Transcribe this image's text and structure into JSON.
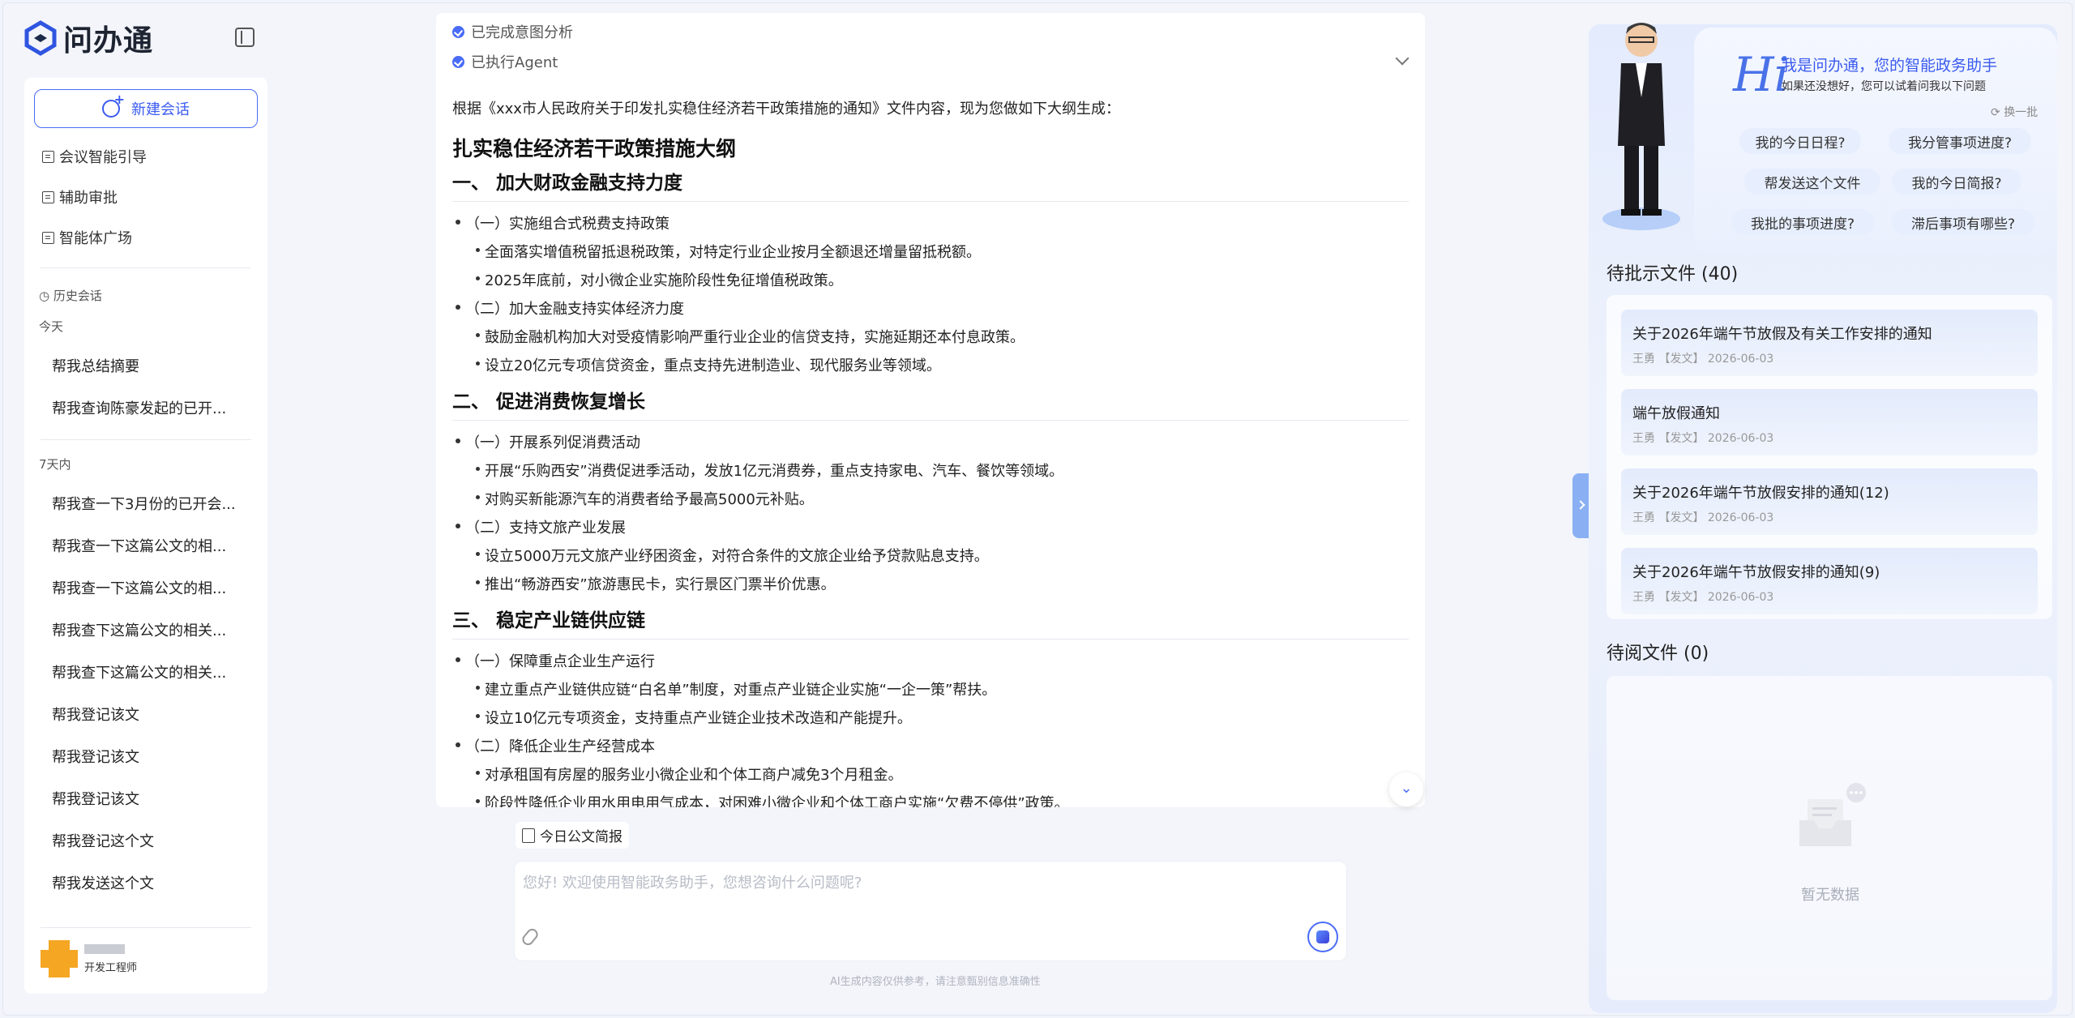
{
  "app": {
    "logo_text": "问办通"
  },
  "sidebar": {
    "new_chat_label": "新建会话",
    "nav": [
      "会议智能引导",
      "辅助审批",
      "智能体广场"
    ],
    "history_label": "历史会话",
    "groups": [
      {
        "label": "今天",
        "items": [
          "帮我总结摘要",
          "帮我查询陈豪发起的已开..."
        ]
      },
      {
        "label": "7天内",
        "items": [
          "帮我查一下3月份的已开会...",
          "帮我查一下这篇公文的相...",
          "帮我查一下这篇公文的相...",
          "帮我查下这篇公文的相关...",
          "帮我查下这篇公文的相关...",
          "帮我登记该文",
          "帮我登记该文",
          "帮我登记该文",
          "帮我登记这个文",
          "帮我发送这个文"
        ]
      }
    ],
    "user": {
      "role": "开发工程师"
    }
  },
  "chat": {
    "steps": [
      "已完成意图分析",
      "已执行Agent"
    ],
    "intro": "根据《xxx市人民政府关于印发扎实稳住经济若干政策措施的通知》文件内容，现为您做如下大纲生成：",
    "doc_title": "扎实稳住经济若干政策措施大纲",
    "sections": [
      {
        "title": "一、 加大财政金融支持力度",
        "items": [
          {
            "label": "（一）实施组合式税费支持政策",
            "subs": [
              "全面落实增值税留抵退税政策，对特定行业企业按月全额退还增量留抵税额。",
              "2025年底前，对小微企业实施阶段性免征增值税政策。"
            ]
          },
          {
            "label": "（二）加大金融支持实体经济力度",
            "subs": [
              "鼓励金融机构加大对受疫情影响严重行业企业的信贷支持，实施延期还本付息政策。",
              "设立20亿元专项信贷资金，重点支持先进制造业、现代服务业等领域。"
            ]
          }
        ]
      },
      {
        "title": "二、 促进消费恢复增长",
        "items": [
          {
            "label": "（一）开展系列促消费活动",
            "subs": [
              "开展“乐购西安”消费促进季活动，发放1亿元消费券，重点支持家电、汽车、餐饮等领域。",
              "对购买新能源汽车的消费者给予最高5000元补贴。"
            ]
          },
          {
            "label": "（二）支持文旅产业发展",
            "subs": [
              "设立5000万元文旅产业纾困资金，对符合条件的文旅企业给予贷款贴息支持。",
              "推出“畅游西安”旅游惠民卡，实行景区门票半价优惠。"
            ]
          }
        ]
      },
      {
        "title": "三、 稳定产业链供应链",
        "items": [
          {
            "label": "（一）保障重点企业生产运行",
            "subs": [
              "建立重点产业链供应链“白名单”制度，对重点产业链企业实施“一企一策”帮扶。",
              "设立10亿元专项资金，支持重点产业链企业技术改造和产能提升。"
            ]
          },
          {
            "label": "（二）降低企业生产经营成本",
            "subs": [
              "对承租国有房屋的服务业小微企业和个体工商户减免3个月租金。",
              "阶段性降低企业用水用电用气成本，对困难小微企业和个体工商户实施“欠费不停供”政策。"
            ]
          }
        ]
      }
    ],
    "brief_chip": "今日公文简报",
    "input_placeholder": "您好! 欢迎使用智能政务助手，您想咨询什么问题呢?",
    "disclaimer": "AI生成内容仅供参考，请注意甄别信息准确性"
  },
  "assistant": {
    "hi": "Hi",
    "greeting": "我是问办通，您的智能政务助手",
    "sub": "如果还没想好，您可以试着问我以下问题",
    "swap": "换一批",
    "questions": [
      "我的今日日程?",
      "我分管事项进度?",
      "帮发送这个文件",
      "我的今日简报?",
      "我批的事项进度?",
      "滞后事项有哪些?"
    ]
  },
  "pending": {
    "title": "待批示文件 (40)",
    "items": [
      {
        "title": "关于2026年端午节放假及有关工作安排的通知",
        "meta": "王勇 【发文】 2026-06-03"
      },
      {
        "title": "端午放假通知",
        "meta": "王勇 【发文】 2026-06-03"
      },
      {
        "title": "关于2026年端午节放假安排的通知(12)",
        "meta": "王勇 【发文】 2026-06-03"
      },
      {
        "title": "关于2026年端午节放假安排的通知(9)",
        "meta": "王勇 【发文】 2026-06-03"
      }
    ]
  },
  "toread": {
    "title": "待阅文件 (0)",
    "empty": "暂无数据"
  },
  "colors": {
    "accent": "#4a6cf7",
    "panel": "#e3ebfd"
  }
}
